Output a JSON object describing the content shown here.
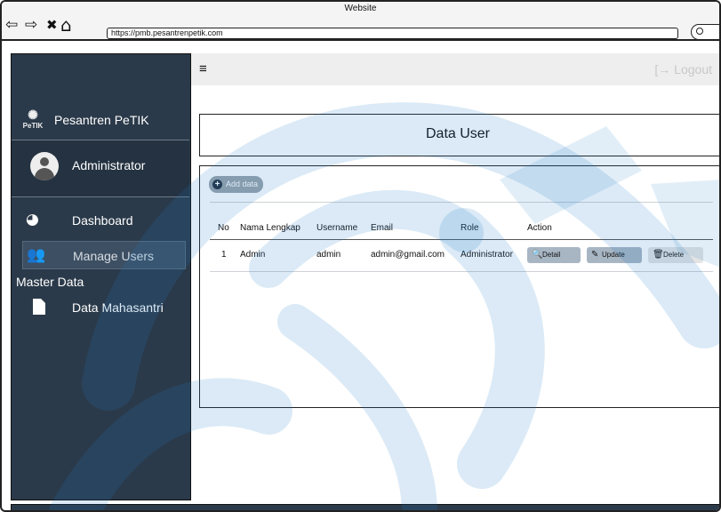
{
  "browser": {
    "window_title": "Website",
    "url": "https://pmb.pesantrenpetik.com",
    "back_icon": "⇦",
    "forward_icon": "⇨",
    "close_icon": "✖",
    "home_icon": "⌂"
  },
  "sidebar": {
    "logo_text": "PeTIK",
    "brand": "Pesantren PeTIK",
    "user": "Administrator",
    "items": [
      {
        "label": "Dashboard",
        "icon": "dashboard-icon"
      },
      {
        "label": "Manage Users",
        "icon": "users-icon",
        "active": true
      }
    ],
    "section_title": "Master Data",
    "section_items": [
      {
        "label": "Data Mahasantri",
        "icon": "document-icon"
      }
    ]
  },
  "topbar": {
    "menu_icon": "≡",
    "logout_label": "Logout",
    "logout_icon": "[→"
  },
  "page": {
    "title": "Data User",
    "add_button": "Add data"
  },
  "table": {
    "headers": [
      "No",
      "Nama Lengkap",
      "Username",
      "Email",
      "Role",
      "Action"
    ],
    "rows": [
      {
        "no": "1",
        "name": "Admin",
        "username": "admin",
        "email": "admin@gmail.com",
        "role": "Administrator"
      }
    ],
    "actions": {
      "detail": "Detail",
      "update": "Update",
      "delete": "Delete"
    }
  },
  "colors": {
    "sidebar": "#2b3a4a",
    "watermark": "#1f7fc4",
    "action_button": "#a8b6c4"
  }
}
